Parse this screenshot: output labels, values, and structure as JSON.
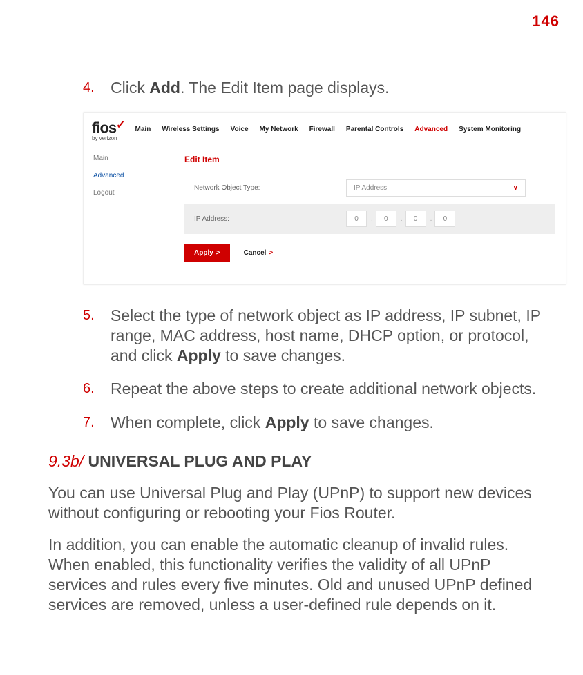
{
  "page_number": "146",
  "steps": {
    "s4": {
      "num": "4.",
      "prefix": "Click ",
      "bold": "Add",
      "suffix": ". The Edit Item page displays."
    },
    "s5": {
      "num": "5.",
      "text_a": "Select the type of network object as IP address, IP subnet, IP range, MAC address, host name, DHCP option, or protocol, and click ",
      "bold": "Apply",
      "text_b": " to save changes."
    },
    "s6": {
      "num": "6.",
      "text": "Repeat the above steps to create additional network objects."
    },
    "s7": {
      "num": "7.",
      "text_a": "When complete, click ",
      "bold": "Apply",
      "text_b": " to save changes."
    }
  },
  "router": {
    "logo": {
      "name": "fios",
      "check": "✓",
      "sub": "by verizon"
    },
    "tabs": [
      "Main",
      "Wireless Settings",
      "Voice",
      "My Network",
      "Firewall",
      "Parental Controls",
      "Advanced",
      "System Monitoring"
    ],
    "active_tab_index": 6,
    "side": {
      "items": [
        "Main",
        "Advanced",
        "Logout"
      ],
      "selected_index": 1
    },
    "panel": {
      "title": "Edit Item",
      "type_label": "Network Object Type:",
      "type_value": "IP Address",
      "ip_label": "IP Address:",
      "ip": [
        "0",
        "0",
        "0",
        "0"
      ],
      "apply": "Apply",
      "cancel": "Cancel"
    }
  },
  "section": {
    "num": "9.3b/",
    "title": " UNIVERSAL PLUG AND PLAY",
    "p1": "You can use Universal Plug and Play (UPnP) to support new devices without configuring or rebooting your Fios Router.",
    "p2": "In addition, you can enable the automatic cleanup of invalid rules. When enabled, this functionality verifies the validity of all UPnP services and rules every five minutes. Old and unused UPnP defined services are removed, unless a user-defined rule depends on it."
  }
}
